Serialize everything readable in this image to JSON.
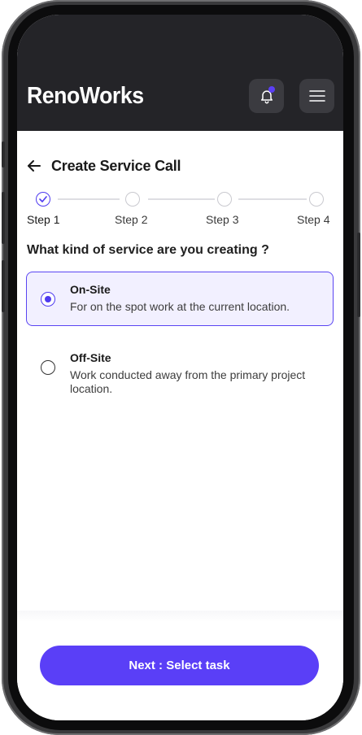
{
  "app": {
    "brand": "RenoWorks"
  },
  "header": {
    "notification_icon": "bell-icon",
    "menu_icon": "hamburger-menu-icon",
    "notification_dot_color": "#5b3ff5"
  },
  "page": {
    "title": "Create Service Call",
    "back_icon": "arrow-left-icon"
  },
  "stepper": {
    "current_step": 1,
    "steps": [
      {
        "label": "Step 1",
        "state": "current"
      },
      {
        "label": "Step 2",
        "state": "upcoming"
      },
      {
        "label": "Step 3",
        "state": "upcoming"
      },
      {
        "label": "Step 4",
        "state": "upcoming"
      }
    ]
  },
  "question": "What kind of service are you creating ?",
  "options": [
    {
      "title": "On-Site",
      "description": "For on the spot work at the current location.",
      "selected": true
    },
    {
      "title": "Off-Site",
      "description": "Work conducted away from the primary project location.",
      "selected": false
    }
  ],
  "footer": {
    "next_label": "Next : Select task"
  },
  "colors": {
    "accent": "#4f3bf0",
    "button": "#5a3ff7",
    "header_bg": "#242428"
  }
}
